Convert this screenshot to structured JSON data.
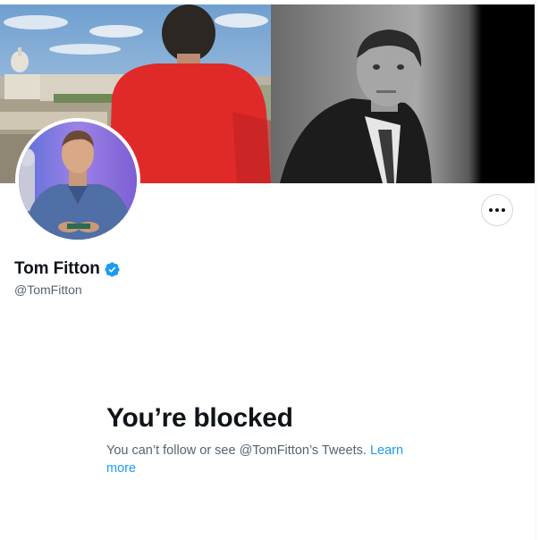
{
  "profile": {
    "display_name": "Tom Fitton",
    "handle": "@TomFitton",
    "verified": true,
    "more_icon": "more-horizontal-icon"
  },
  "blocked": {
    "title": "You’re blocked",
    "message": "You can’t follow or see @TomFitton’s Tweets.",
    "link_label": "Learn more"
  },
  "colors": {
    "text": "#0f1419",
    "secondary": "#536471",
    "link": "#1d9bf0",
    "verified": "#1d9bf0"
  }
}
